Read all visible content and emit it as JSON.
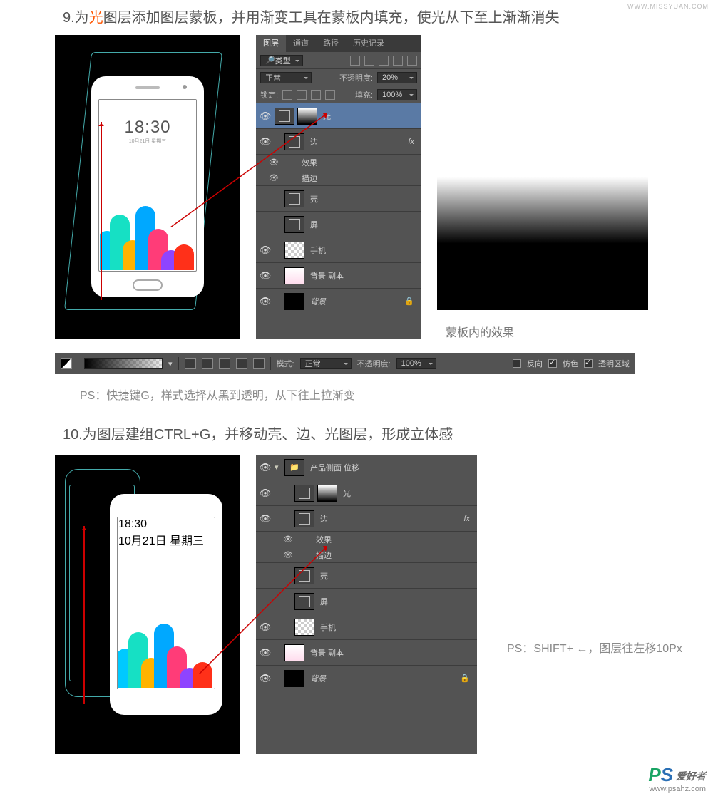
{
  "watermark_top": "WWW.MISSYUAN.COM",
  "step9": {
    "prefix": "9.为",
    "highlight": "光",
    "suffix": "图层添加图层蒙板，并用渐变工具在蒙板内填充，使光从下至上渐渐消失"
  },
  "phone": {
    "time": "18:30",
    "date": "10月21日 星期三"
  },
  "layers": {
    "tabs": {
      "layers": "图层",
      "channels": "通道",
      "paths": "路径",
      "history": "历史记录"
    },
    "type_label": "类型",
    "blend": "正常",
    "opacity_label": "不透明度:",
    "opacity_val": "20%",
    "lock_label": "锁定:",
    "fill_label": "填充:",
    "fill_val": "100%",
    "items": {
      "light": "光",
      "edge": "边",
      "fx": "效果",
      "stroke": "描边",
      "shell": "壳",
      "screen": "屏",
      "phone": "手机",
      "bgcopy": "背景 副本",
      "bg": "背景"
    },
    "fx_badge": "fx"
  },
  "mask_caption": "蒙板内的效果",
  "toolbar": {
    "mode_label": "模式:",
    "mode_val": "正常",
    "opacity_label": "不透明度:",
    "opacity_val": "100%",
    "reverse": "反向",
    "dither": "仿色",
    "transparency": "透明区域"
  },
  "ps_note": "PS：快捷键G，样式选择从黑到透明，从下往上拉渐变",
  "step10": "10.为图层建组CTRL+G，并移动壳、边、光图层，形成立体感",
  "layers2": {
    "group": "产品侧面 位移",
    "light": "光",
    "edge": "边",
    "fx": "效果",
    "stroke": "描边",
    "shell": "壳",
    "screen": "屏",
    "phone": "手机",
    "bgcopy": "背景 副本",
    "bg": "背景"
  },
  "shift_note": "PS：SHIFT+ ←，图层往左移10Px",
  "watermark": {
    "logo_p": "P",
    "logo_s": "S",
    "cn": "爱好者",
    "url": "www.psahz.com"
  }
}
